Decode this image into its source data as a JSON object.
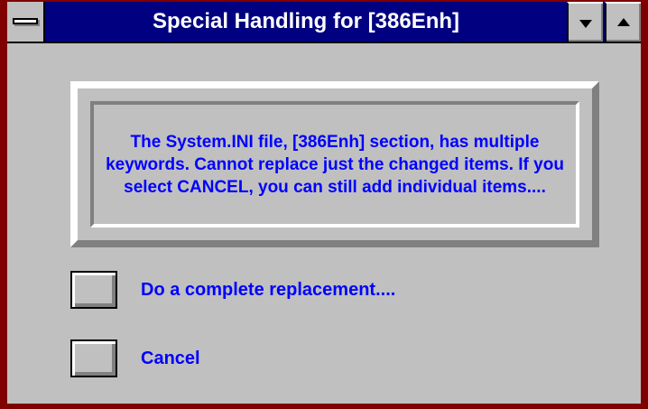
{
  "window": {
    "title": "Special Handling for [386Enh]"
  },
  "message": {
    "text": "The System.INI file, [386Enh] section, has multiple keywords.  Cannot replace just the changed items.  If you select CANCEL, you can still add individual items...."
  },
  "options": [
    {
      "label": "Do a complete replacement...."
    },
    {
      "label": "Cancel"
    }
  ],
  "colors": {
    "titlebar": "#000080",
    "text": "#0000ff",
    "face": "#c0c0c0",
    "frame": "#800000"
  }
}
